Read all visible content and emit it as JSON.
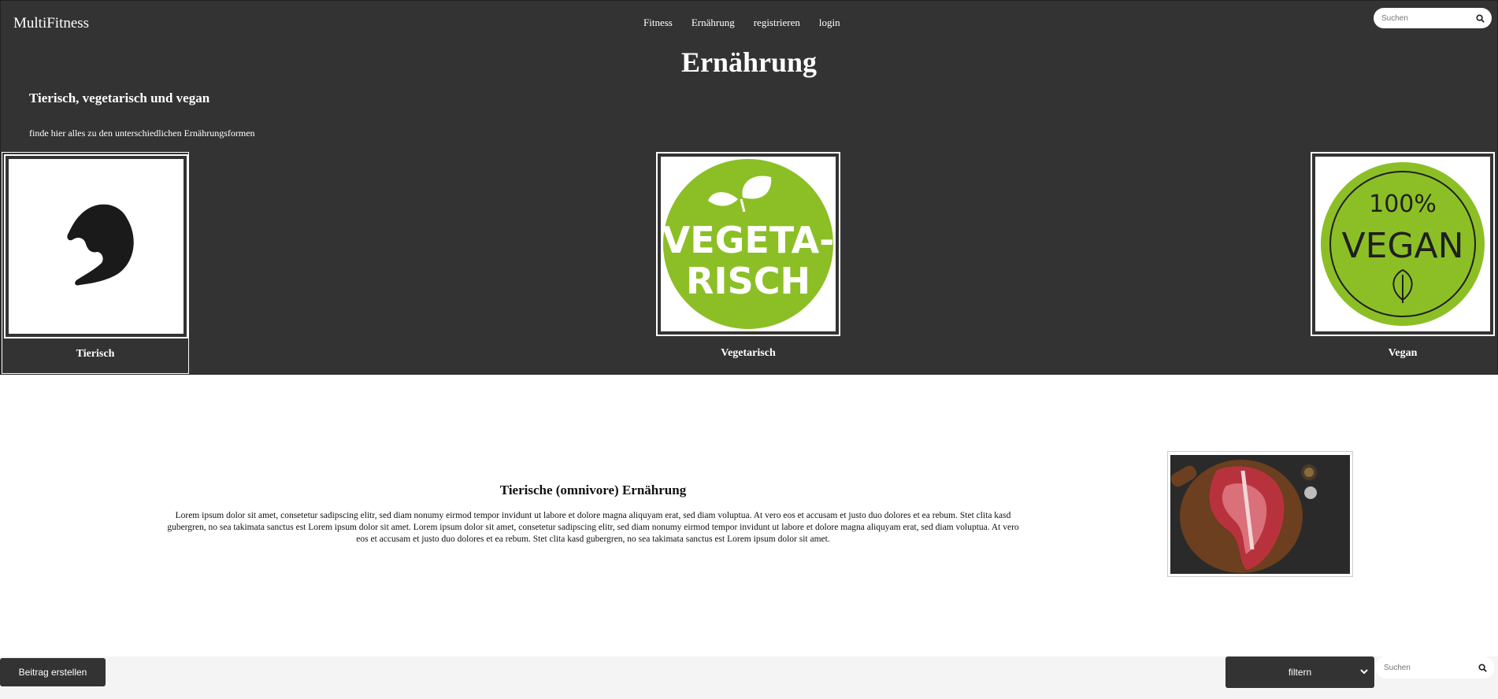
{
  "header": {
    "logo": "MultiFitness",
    "nav": [
      "Fitness",
      "Ernährung",
      "registrieren",
      "login"
    ],
    "search_placeholder": "Suchen"
  },
  "hero": {
    "title": "Ernährung",
    "subtitle": "Tierisch, vegetarisch und vegan",
    "intro": "finde hier alles zu den unterschiedlichen Ernährungsformen"
  },
  "cards": [
    {
      "label": "Tierisch",
      "icon": "muscle-arm-icon"
    },
    {
      "label": "Vegetarisch",
      "icon": "vegetarisch-badge",
      "badge_text_1": "VEGETA-",
      "badge_text_2": "RISCH"
    },
    {
      "label": "Vegan",
      "icon": "vegan-badge",
      "badge_text_1": "100%",
      "badge_text_2": "VEGAN"
    }
  ],
  "article": {
    "title": "Tierische (omnivore) Ernährung",
    "body": "Lorem ipsum dolor sit amet, consetetur sadipscing elitr, sed diam nonumy eirmod tempor invidunt ut labore et dolore magna aliquyam erat, sed diam voluptua. At vero eos et accusam et justo duo dolores et ea rebum. Stet clita kasd gubergren, no sea takimata sanctus est Lorem ipsum dolor sit amet. Lorem ipsum dolor sit amet, consetetur sadipscing elitr, sed diam nonumy eirmod tempor invidunt ut labore et dolore magna aliquyam erat, sed diam voluptua. At vero eos et accusam et justo duo dolores et ea rebum. Stet clita kasd gubergren, no sea takimata sanctus est Lorem ipsum dolor sit amet."
  },
  "footer": {
    "create_button": "Beitrag erstellen",
    "filter_label": "filtern",
    "search_placeholder": "Suchen"
  },
  "colors": {
    "dark": "#333333",
    "green": "#8cbf26"
  }
}
